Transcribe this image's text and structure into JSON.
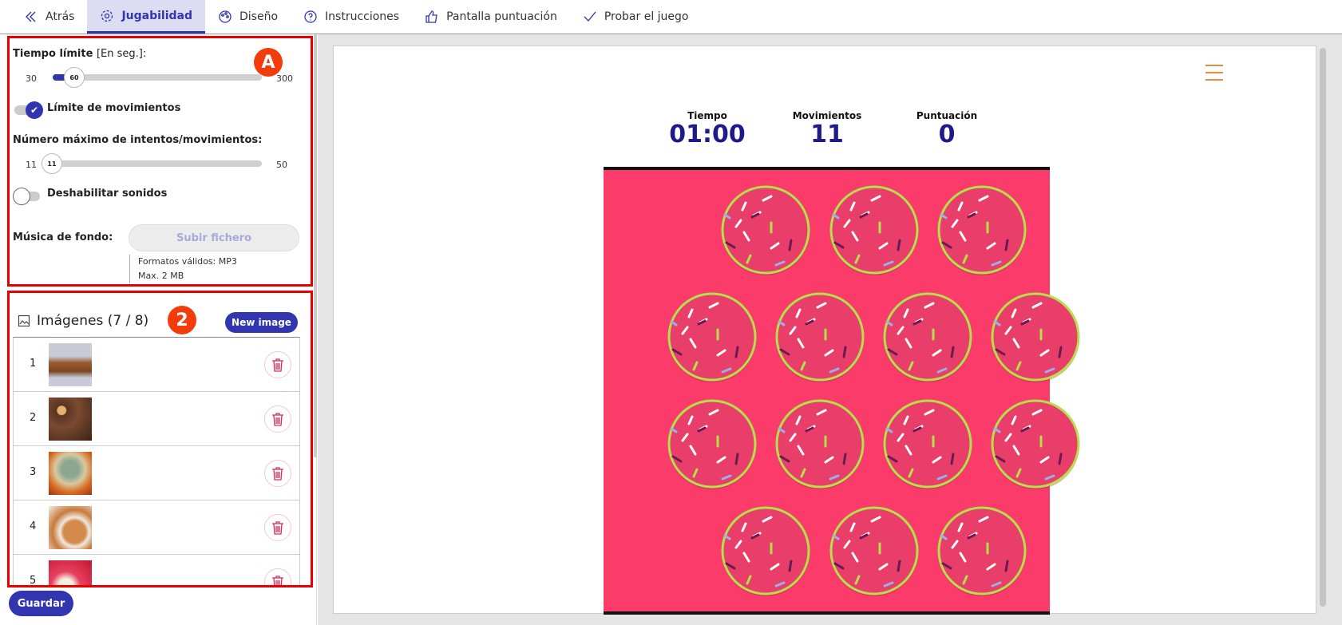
{
  "nav": {
    "tabs": [
      {
        "label": "Atrás",
        "icon": "double-chevron-left-icon"
      },
      {
        "label": "Jugabilidad",
        "icon": "gear-icon",
        "active": true
      },
      {
        "label": "Diseño",
        "icon": "palette-icon"
      },
      {
        "label": "Instrucciones",
        "icon": "question-circle-icon"
      },
      {
        "label": "Pantalla puntuación",
        "icon": "thumbs-up-icon"
      },
      {
        "label": "Probar el juego",
        "icon": "checkmark-icon"
      }
    ]
  },
  "settings": {
    "badge": "A",
    "time_label": "Tiempo límite",
    "time_unit": "[En seg.]:",
    "time_min": "30",
    "time_max": "300",
    "time_value": "60",
    "moves_limit_label": "Límite de movimientos",
    "moves_limit_on": true,
    "max_moves_label": "Número máximo de intentos/movimientos:",
    "moves_min": "11",
    "moves_max": "50",
    "moves_value": "11",
    "disable_sounds_label": "Deshabilitar sonidos",
    "disable_sounds_on": false,
    "music_label": "Música de fondo:",
    "upload_label": "Subir fichero",
    "formats": "Formatos válidos: MP3",
    "max_size": "Max. 2 MB"
  },
  "images": {
    "badge": "2",
    "title": "Imágenes (7 / 8)",
    "new_button": "New image",
    "rows": [
      {
        "n": "1",
        "img": "cookies"
      },
      {
        "n": "2",
        "img": "cereal"
      },
      {
        "n": "3",
        "img": "muffin"
      },
      {
        "n": "4",
        "img": "smiley-cookies"
      },
      {
        "n": "5",
        "img": "sweets"
      }
    ]
  },
  "save_button": "Guardar",
  "game": {
    "time_label": "Tiempo",
    "time_value": "01:00",
    "moves_label": "Movimientos",
    "moves_value": "11",
    "score_label": "Puntuación",
    "score_value": "0",
    "board_color": "#fb3b69",
    "accent": "#3135b0",
    "card_rows": [
      3,
      4,
      4,
      3
    ]
  }
}
